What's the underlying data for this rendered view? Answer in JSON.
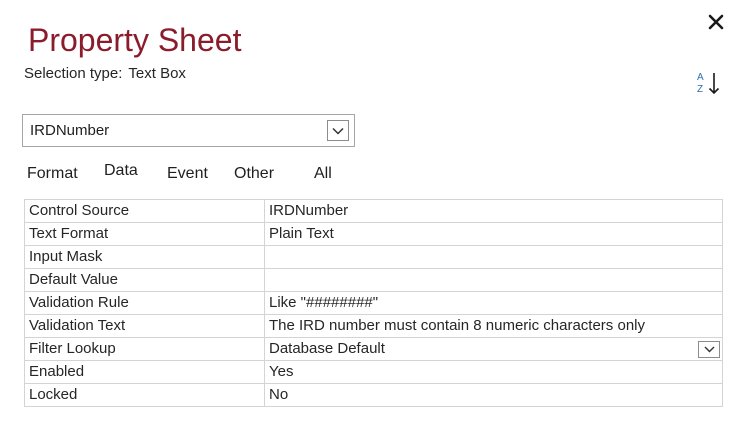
{
  "header": {
    "title": "Property Sheet",
    "selection_label": "Selection type:",
    "selection_value": "Text Box",
    "close_icon": "close-icon",
    "sort_icon": "sort-az-icon",
    "sort_label_a": "A",
    "sort_label_z": "Z"
  },
  "selector": {
    "value": "IRDNumber",
    "icon": "chevron-down-icon"
  },
  "tabs": [
    {
      "label": "Format",
      "active": false
    },
    {
      "label": "Data",
      "active": true
    },
    {
      "label": "Event",
      "active": false
    },
    {
      "label": "Other",
      "active": false
    },
    {
      "label": "All",
      "active": false
    }
  ],
  "properties": [
    {
      "name": "Control Source",
      "value": "IRDNumber"
    },
    {
      "name": "Text Format",
      "value": "Plain Text"
    },
    {
      "name": "Input Mask",
      "value": ""
    },
    {
      "name": "Default Value",
      "value": ""
    },
    {
      "name": "Validation Rule",
      "value": "Like \"########\""
    },
    {
      "name": "Validation Text",
      "value": "The IRD number must contain 8 numeric characters only"
    },
    {
      "name": "Filter Lookup",
      "value": "Database Default",
      "has_dropdown": true
    },
    {
      "name": "Enabled",
      "value": "Yes"
    },
    {
      "name": "Locked",
      "value": "No"
    }
  ],
  "colors": {
    "title": "#8a1c2b",
    "sort_accent": "#2e6fb5",
    "grid_border": "#d4d4d4"
  }
}
